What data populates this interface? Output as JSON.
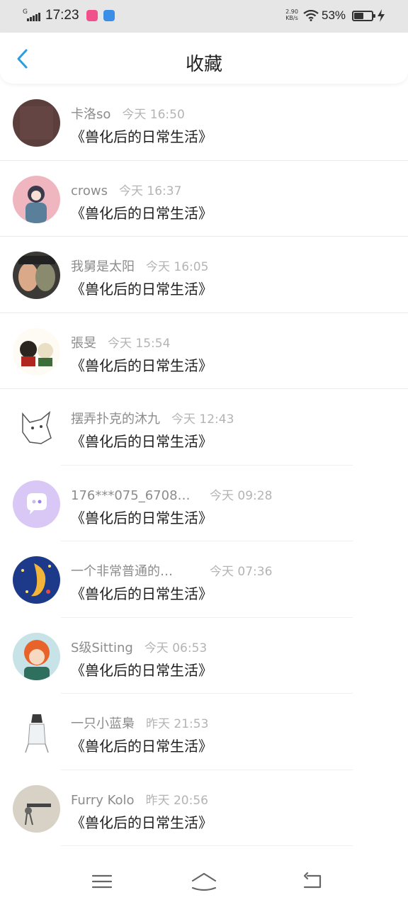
{
  "status_bar": {
    "carrier_glyph": "G",
    "time": "17:23",
    "net_speed_value": "2.90",
    "net_speed_unit": "KB/s",
    "battery_percent": "53%",
    "battery_level": 0.53,
    "icons": [
      "signal-icon",
      "app-notification-icon",
      "app-notification-icon-2",
      "wifi-icon",
      "battery-icon",
      "charging-icon"
    ]
  },
  "header": {
    "title": "收藏",
    "back_icon": "chevron-left-icon",
    "accent_color": "#2a9ee0"
  },
  "favorites": [
    {
      "username": "卡洛so",
      "time": "今天 16:50",
      "book": "《兽化后的日常生活》"
    },
    {
      "username": "crows",
      "time": "今天 16:37",
      "book": "《兽化后的日常生活》"
    },
    {
      "username": "我舅是太阳",
      "time": "今天 16:05",
      "book": "《兽化后的日常生活》"
    },
    {
      "username": "張旻",
      "time": "今天 15:54",
      "book": "《兽化后的日常生活》"
    },
    {
      "username": "摆弄扑克的沐九",
      "time": "今天 12:43",
      "book": "《兽化后的日常生活》"
    },
    {
      "username": "176***075_6708…",
      "time": "今天 09:28",
      "book": "《兽化后的日常生活》"
    },
    {
      "username": "一个非常普通的…",
      "time": "今天 07:36",
      "book": "《兽化后的日常生活》"
    },
    {
      "username": "S级Sitting",
      "time": "今天 06:53",
      "book": "《兽化后的日常生活》"
    },
    {
      "username": "一只小蓝梟",
      "time": "昨天 21:53",
      "book": "《兽化后的日常生活》"
    },
    {
      "username": "Furry Kolo",
      "time": "昨天 20:56",
      "book": "《兽化后的日常生活》"
    }
  ],
  "nav_bar": {
    "icons": [
      "menu-icon",
      "home-icon",
      "back-icon"
    ]
  }
}
